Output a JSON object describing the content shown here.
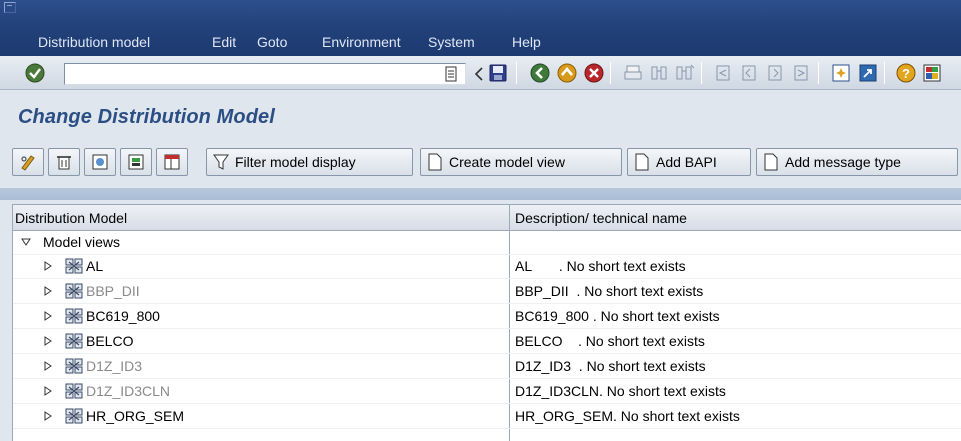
{
  "menu": [
    "Distribution model",
    "Edit",
    "Goto",
    "Environment",
    "System",
    "Help"
  ],
  "command_field": {
    "value": ""
  },
  "title": "Change Distribution Model",
  "app_toolbar": {
    "filter_label": "Filter model display",
    "create_view_label": "Create model view",
    "add_bapi_label": "Add BAPI",
    "add_message_label": "Add message type"
  },
  "tree": {
    "col1": "Distribution Model",
    "col2": "Description/ technical name",
    "root_label": "Model views",
    "rows": [
      {
        "name": "AL",
        "desc": "AL       . No short text exists",
        "inactive": false
      },
      {
        "name": "BBP_DII",
        "desc": "BBP_DII  . No short text exists",
        "inactive": true
      },
      {
        "name": "BC619_800",
        "desc": "BC619_800 . No short text exists",
        "inactive": false
      },
      {
        "name": "BELCO",
        "desc": "BELCO    . No short text exists",
        "inactive": false
      },
      {
        "name": "D1Z_ID3",
        "desc": "D1Z_ID3  . No short text exists",
        "inactive": true
      },
      {
        "name": "D1Z_ID3CLN",
        "desc": "D1Z_ID3CLN. No short text exists",
        "inactive": true
      },
      {
        "name": "HR_ORG_SEM",
        "desc": "HR_ORG_SEM. No short text exists",
        "inactive": false
      }
    ]
  },
  "colors": {
    "title": "#2b4f84",
    "menubar": "#22417a",
    "inactive_text": "#8a8a8a"
  }
}
